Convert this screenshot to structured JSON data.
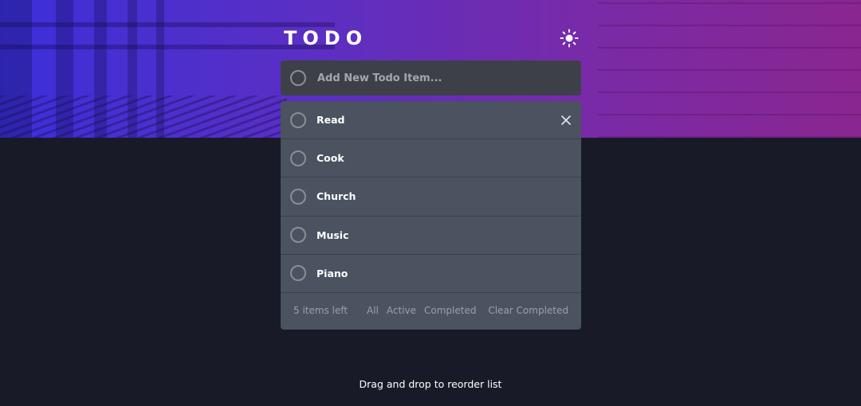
{
  "header": {
    "title": "TODO",
    "theme_icon": "sun-icon"
  },
  "new_todo": {
    "placeholder": "Add New Todo Item...",
    "value": ""
  },
  "todos": [
    {
      "label": "Read",
      "completed": false
    },
    {
      "label": "Cook",
      "completed": false
    },
    {
      "label": "Church",
      "completed": false
    },
    {
      "label": "Music",
      "completed": false
    },
    {
      "label": "Piano",
      "completed": false
    }
  ],
  "footer": {
    "items_left": "5 items left",
    "filters": [
      "All",
      "Active",
      "Completed"
    ],
    "clear_label": "Clear Completed"
  },
  "hint": "Drag and drop to reorder list",
  "colors": {
    "background": "#181b27",
    "card": "#4a535f",
    "input": "#3e4048",
    "gradient_start": "#3b2fd9",
    "gradient_end": "#8a2690"
  }
}
